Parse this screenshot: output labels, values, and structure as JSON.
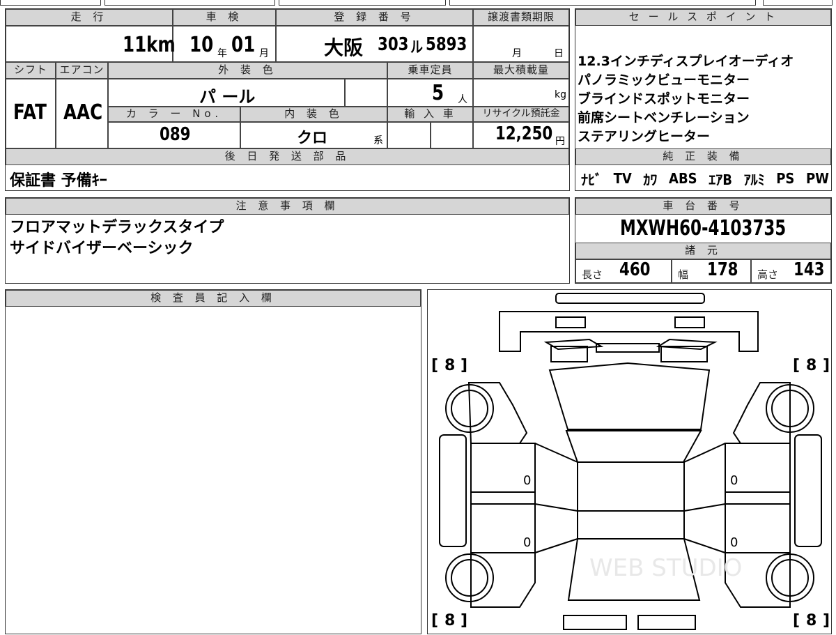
{
  "header": {
    "mileage_label": "走 行",
    "inspection_label": "車 検",
    "registration_label": "登 録 番 号",
    "transfer_deadline_label": "譲渡書類期限",
    "sales_points_label": "セ ー ル ス ポ イ ン ト"
  },
  "row1": {
    "mileage_value": "11",
    "mileage_unit": "km",
    "inspection_year": "10",
    "inspection_year_unit": "年",
    "inspection_month": "01",
    "inspection_month_unit": "月",
    "plate_region": "大阪",
    "plate_class": "303",
    "plate_kana": "ル",
    "plate_number": "5893",
    "deadline_month_unit": "月",
    "deadline_day_unit": "日"
  },
  "row2": {
    "shift_label": "シフト",
    "aircon_label": "エアコン",
    "exterior_color_label": "外 装 色",
    "capacity_label": "乗車定員",
    "max_load_label": "最大積載量",
    "shift_value": "FAT",
    "aircon_value": "AAC",
    "exterior_color_value": "パ ール",
    "capacity_value": "5",
    "capacity_unit": "人",
    "max_load_unit": "kg",
    "color_no_label": "カ ラ ー No.",
    "interior_color_label": "内 装 色",
    "import_label": "輸 入 車",
    "recycle_label": "リサイクル預託金",
    "color_no_value": "089",
    "interior_color_value": "クロ",
    "interior_color_unit": "系",
    "recycle_value": "12,250",
    "recycle_unit": "円"
  },
  "sales_points": [
    "12.3インチディスプレイオーディオ",
    "パノラミックビューモニター",
    "ブラインドスポットモニター",
    "前席シートベンチレーション",
    "ステアリングヒーター"
  ],
  "later_parts": {
    "label": "後 日 発 送 部 品",
    "value": "保証書 予備ｷｰ"
  },
  "standard_equipment": {
    "label": "純 正 装 備",
    "items": [
      "ﾅﾋﾞ",
      "TV",
      "ｶﾜ",
      "ABS",
      "ｴｱB",
      "ｱﾙﾐ",
      "PS",
      "PW"
    ]
  },
  "notes": {
    "label": "注 意 事 項 欄",
    "lines": [
      "フロアマットデラックスタイプ",
      "サイドバイザーベーシック"
    ]
  },
  "chassis": {
    "label": "車 台 番 号",
    "value": "MXWH60-4103735"
  },
  "specs": {
    "label": "諸 元",
    "length_label": "長さ",
    "length_value": "460",
    "width_label": "幅",
    "width_value": "178",
    "height_label": "高さ",
    "height_value": "143"
  },
  "inspector": {
    "label": "検 査 員 記 入 欄"
  },
  "diagram": {
    "tread_front_left": "8",
    "tread_front_right": "8",
    "tread_rear_left": "8",
    "tread_rear_right": "8",
    "door_front_left": "0",
    "door_front_right": "0",
    "door_rear_left": "0",
    "door_rear_right": "0",
    "watermark": "WEB STUDIO"
  }
}
